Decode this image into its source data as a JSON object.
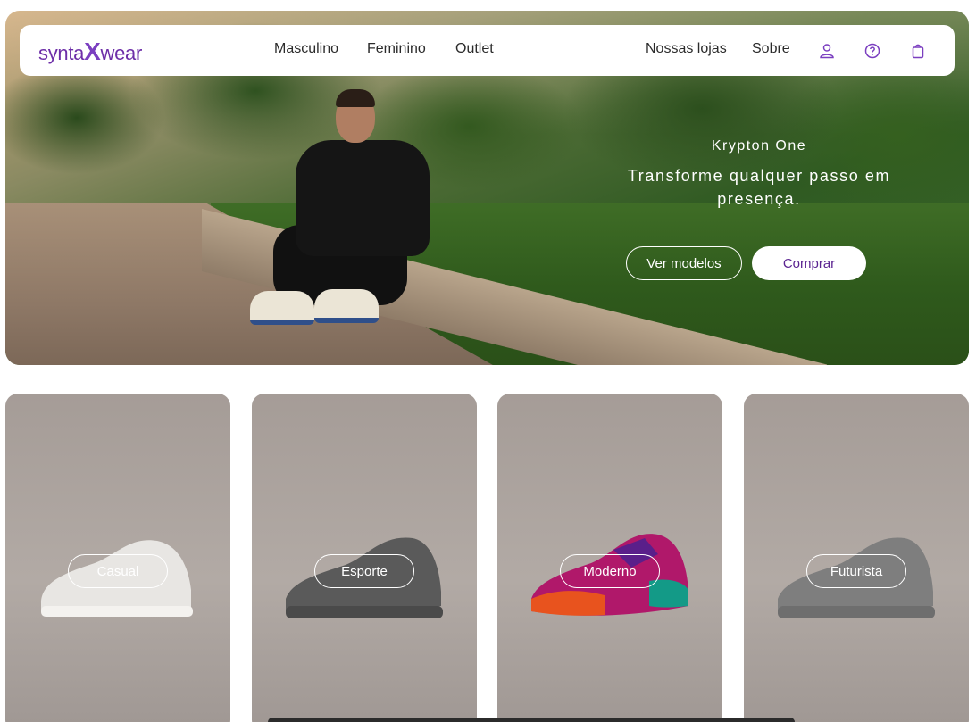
{
  "brand": {
    "logo_pre": "synta",
    "logo_x": "X",
    "logo_post": "wear",
    "accent": "#6d2ea8"
  },
  "nav": {
    "links": [
      "Masculino",
      "Feminino",
      "Outlet"
    ],
    "right_links": [
      "Nossas lojas",
      "Sobre"
    ],
    "icons": [
      "user-icon",
      "help-icon",
      "bag-icon"
    ]
  },
  "hero": {
    "subtitle": "Krypton One",
    "title": "Transforme qualquer passo em presença.",
    "btn_secondary": "Ver modelos",
    "btn_primary": "Comprar"
  },
  "categories": [
    {
      "label": "Casual",
      "shoe_color": "#e8e6e3"
    },
    {
      "label": "Esporte",
      "shoe_color": "#5a5a5a"
    },
    {
      "label": "Moderno",
      "shoe_color": "#b0186a"
    },
    {
      "label": "Futurista",
      "shoe_color": "#7e7e7e"
    }
  ]
}
